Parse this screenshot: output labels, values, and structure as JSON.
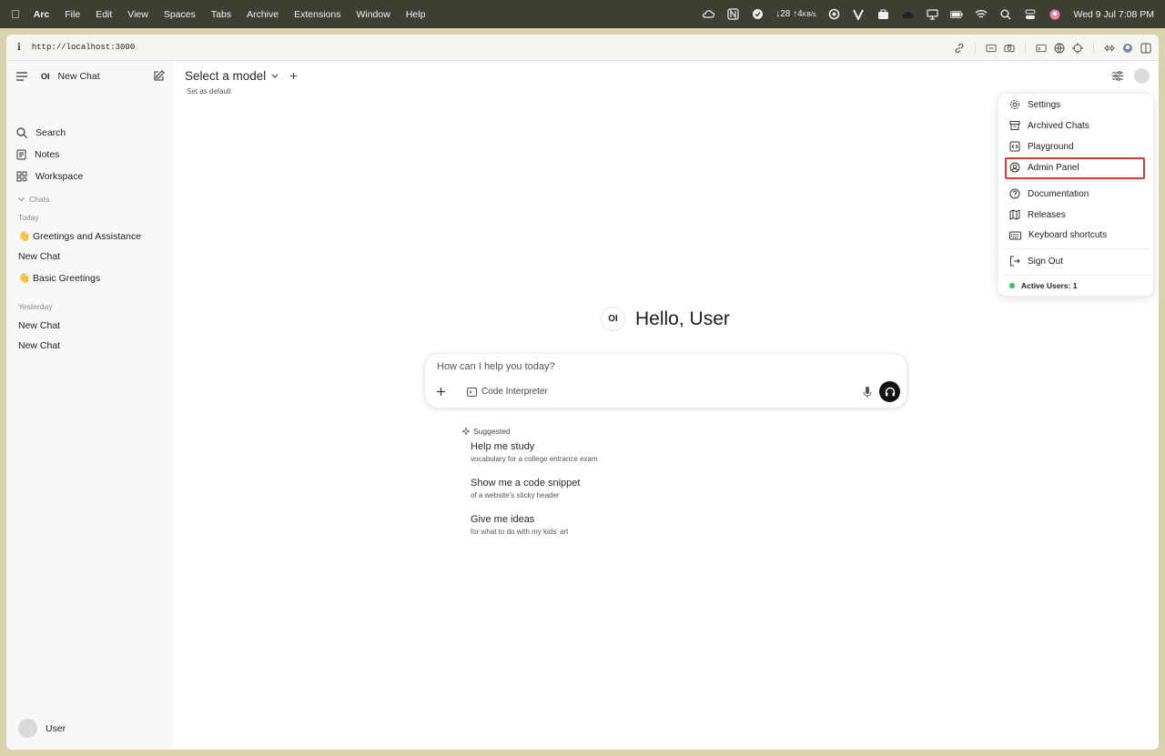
{
  "menubar": {
    "app": "Arc",
    "items": [
      "File",
      "Edit",
      "View",
      "Spaces",
      "Tabs",
      "Archive",
      "Extensions",
      "Window",
      "Help"
    ],
    "net_down": "↓28",
    "net_up": "↑4",
    "net_unit": "KB/s",
    "clock": "Wed 9 Jul  7:08 PM"
  },
  "browser": {
    "info_glyph": "i",
    "url": "http://localhost:3000"
  },
  "sidebar": {
    "logo": "OI",
    "new_chat": "New Chat",
    "search": "Search",
    "notes": "Notes",
    "workspace": "Workspace",
    "chats_header": "Chats",
    "today": "Today",
    "today_items": [
      "👋 Greetings and Assistance",
      "New Chat",
      "👋 Basic Greetings"
    ],
    "yesterday": "Yesterday",
    "yesterday_items": [
      "New Chat",
      "New Chat"
    ],
    "user": "User"
  },
  "main": {
    "model_title": "Select a model",
    "set_default": "Set as default",
    "hello_logo": "OI",
    "hello": "Hello, User",
    "placeholder": "How can I help you today?",
    "tool_label": "Code Interpreter",
    "suggested_header": "Suggested",
    "suggestions": [
      {
        "title": "Help me study",
        "subtitle": "vocabulary for a college entrance exam"
      },
      {
        "title": "Show me a code snippet",
        "subtitle": "of a website's sticky header"
      },
      {
        "title": "Give me ideas",
        "subtitle": "for what to do with my kids' art"
      }
    ]
  },
  "menu": {
    "items": [
      "Settings",
      "Archived Chats",
      "Playground",
      "Admin Panel",
      "Documentation",
      "Releases",
      "Keyboard shortcuts",
      "Sign Out"
    ],
    "active_users": "Active Users: 1",
    "highlight_color": "#d23b36"
  }
}
